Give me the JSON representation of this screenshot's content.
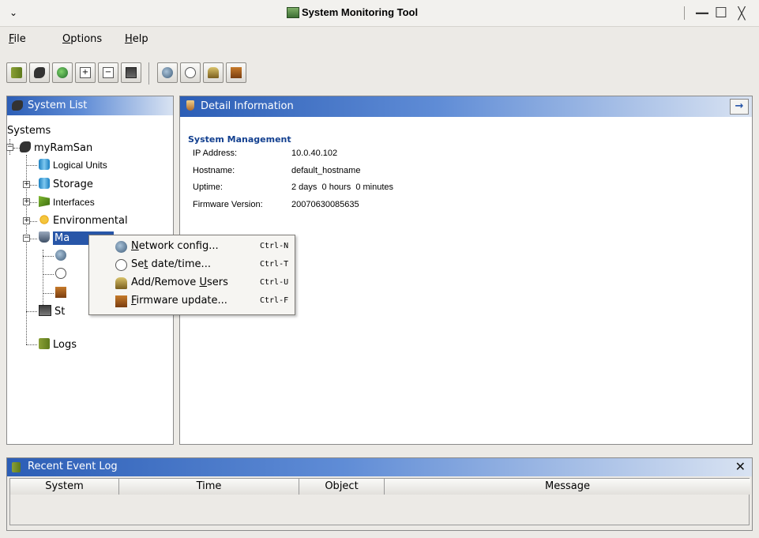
{
  "window": {
    "title": "System Monitoring Tool",
    "menu_glyph": "⌄",
    "minimize_glyph": "—",
    "maximize_glyph": "☐",
    "close_glyph": "╳"
  },
  "menubar": {
    "file": {
      "u": "F",
      "rest": "ile"
    },
    "options": {
      "u": "O",
      "rest": "ptions"
    },
    "help": {
      "u": "H",
      "rest": "elp"
    }
  },
  "toolbar": {
    "group1": [
      "storage-icon",
      "system-icon",
      "network-globe-icon",
      "expand-tree-icon",
      "collapse-tree-icon",
      "statistics-icon"
    ],
    "group2": [
      "network-config-icon",
      "set-time-icon",
      "users-icon",
      "firmware-icon"
    ]
  },
  "system_list": {
    "title": "System List",
    "root": "Systems",
    "system": "myRamSan",
    "nodes": {
      "logical_units": "Logical Units",
      "storage": "Storage",
      "interfaces": "Interfaces",
      "environmental": "Environmental",
      "management_prefix": "Ma",
      "statistics_prefix": "St",
      "logs": "Logs"
    }
  },
  "detail": {
    "title": "Detail Information",
    "section": "System Management",
    "rows": [
      {
        "label": "IP Address:",
        "value": "10.0.40.102"
      },
      {
        "label": "Hostname:",
        "value": "default_hostname"
      },
      {
        "label": "Uptime:",
        "value": "2 days  0 hours  0 minutes"
      },
      {
        "label": "Firmware Version:",
        "value": "20070630085635"
      }
    ]
  },
  "context_menu": {
    "items": [
      {
        "u": "N",
        "rest": "etwork config...",
        "pre": "",
        "shortcut": "Ctrl-N"
      },
      {
        "pre": "Se",
        "u": "t",
        "rest": " date/time...",
        "shortcut": "Ctrl-T"
      },
      {
        "pre": "Add/Remove ",
        "u": "U",
        "rest": "sers",
        "shortcut": "Ctrl-U"
      },
      {
        "pre": "",
        "u": "F",
        "rest": "irmware update...",
        "shortcut": "Ctrl-F"
      }
    ]
  },
  "event_log": {
    "title": "Recent Event Log",
    "close_glyph": "✕",
    "columns": [
      "System",
      "Time",
      "Object",
      "Message"
    ]
  }
}
